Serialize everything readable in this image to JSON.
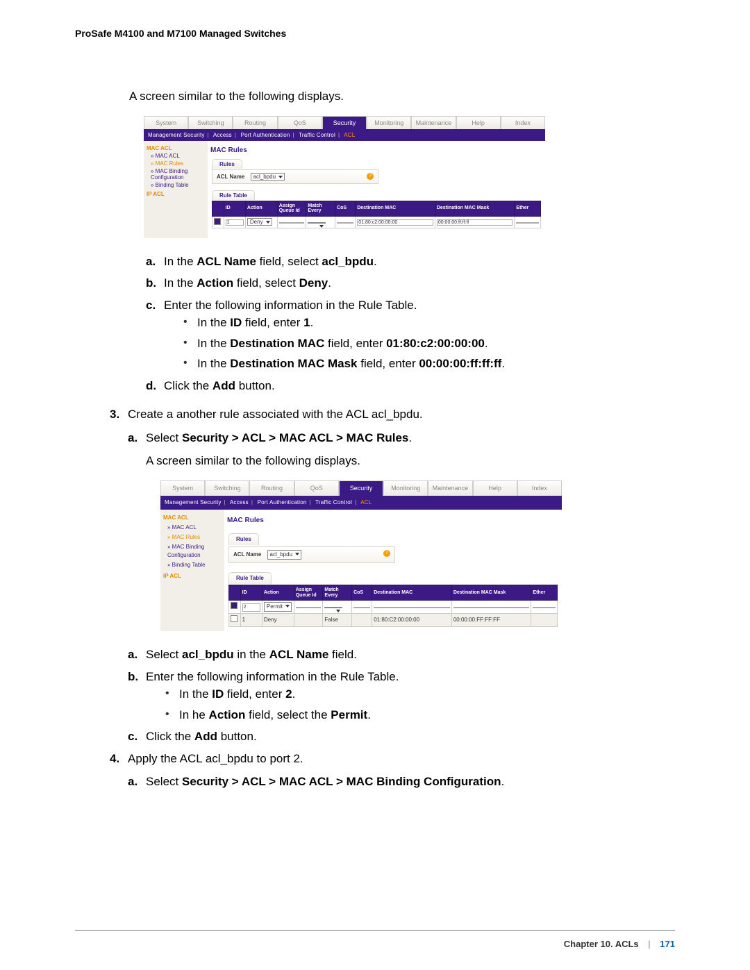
{
  "header": {
    "title": "ProSafe M4100 and M7100 Managed Switches"
  },
  "intro1": "A screen similar to the following displays.",
  "screenshot1": {
    "top_tabs": [
      "System",
      "Switching",
      "Routing",
      "QoS",
      "Security",
      "Monitoring",
      "Maintenance",
      "Help",
      "Index"
    ],
    "active_tab": "Security",
    "sub_tabs": [
      "Management Security",
      "Access",
      "Port Authentication",
      "Traffic Control",
      "ACL"
    ],
    "sub_sel": "ACL",
    "sidebar": {
      "heading1": "MAC ACL",
      "items": [
        "MAC ACL",
        "MAC Rules",
        "MAC Binding Configuration",
        "Binding Table"
      ],
      "sel": "MAC Rules",
      "heading2": "IP ACL"
    },
    "panel_title": "MAC Rules",
    "rules": {
      "tab": "Rules",
      "label": "ACL Name",
      "value": "acl_bpdu"
    },
    "rule_table": {
      "tab": "Rule Table",
      "headers": [
        "",
        "ID",
        "Action",
        "Assign Queue Id",
        "Match Every",
        "CoS",
        "Destination MAC",
        "Destination MAC Mask",
        "Ether"
      ],
      "rows": [
        {
          "checked": true,
          "id": "1",
          "action": "Deny",
          "assign": "",
          "match": "",
          "cos": "",
          "dmac": "01:80:c2:00:00:00",
          "dmask": "00:00:00:ff:ff:ff",
          "ether": ""
        }
      ]
    }
  },
  "steps_a": [
    {
      "m": "a.",
      "pre": "In the ",
      "b1": "ACL Name",
      "mid": " field, select ",
      "b2": "acl_bpdu",
      "post": "."
    },
    {
      "m": "b.",
      "pre": "In the ",
      "b1": "Action",
      "mid": " field, select ",
      "b2": "Deny",
      "post": "."
    },
    {
      "m": "c.",
      "text": "Enter the following information in the Rule Table."
    }
  ],
  "bullets_a": [
    {
      "pre": "In the ",
      "b1": "ID",
      "mid": " field, enter ",
      "b2": "1",
      "post": "."
    },
    {
      "pre": "In the ",
      "b1": "Destination MAC",
      "mid": " field, enter ",
      "b2": "01:80:c2:00:00:00",
      "post": "."
    },
    {
      "pre": "In the ",
      "b1": "Destination MAC Mask",
      "mid": " field, enter ",
      "b2": "00:00:00:ff:ff:ff",
      "post": "."
    }
  ],
  "step_d": {
    "m": "d.",
    "pre": "Click the ",
    "b1": "Add",
    "post": " button."
  },
  "step3": {
    "num": "3.",
    "text": "Create a another rule associated with the ACL acl_bpdu.",
    "a": {
      "m": "a.",
      "pre": "Select ",
      "b1": "Security > ACL > MAC ACL > MAC Rules",
      "post": "."
    },
    "intro": "A screen similar to the following displays."
  },
  "screenshot2": {
    "rule_table": {
      "rows": [
        {
          "checked": true,
          "gray": false,
          "id": "2",
          "action": "Permit",
          "action_dd": true,
          "assign": "",
          "match": "",
          "match_dd": true,
          "cos": "",
          "dmac": "",
          "dmask": "",
          "ether": ""
        },
        {
          "checked": false,
          "gray": true,
          "id": "1",
          "action": "Deny",
          "action_dd": false,
          "assign": "",
          "match": "False",
          "match_dd": false,
          "cos": "",
          "dmac": "01:80:C2:00:00:00",
          "dmask": "00:00:00:FF:FF:FF",
          "ether": ""
        }
      ]
    }
  },
  "steps_b": [
    {
      "m": "a.",
      "pre": "Select ",
      "b1": "acl_bpdu",
      "mid": " in the ",
      "b2": "ACL Name",
      "post": " field."
    },
    {
      "m": "b.",
      "text": "Enter the following information in the Rule Table."
    }
  ],
  "bullets_b": [
    {
      "pre": "In the ",
      "b1": "ID",
      "mid": " field, enter ",
      "b2": "2",
      "post": "."
    },
    {
      "pre": "In he ",
      "b1": "Action",
      "mid": " field, select the ",
      "b2": "Permit",
      "post": "."
    }
  ],
  "step_c2": {
    "m": "c.",
    "pre": "Click the ",
    "b1": "Add",
    "post": " button."
  },
  "step4": {
    "num": "4.",
    "text": "Apply the ACL acl_bpdu to port 2.",
    "a": {
      "m": "a.",
      "pre": "Select ",
      "b1": "Security > ACL > MAC ACL > MAC Binding Configuration",
      "post": "."
    }
  },
  "footer": {
    "chapter": "Chapter 10.  ACLs",
    "page": "171"
  }
}
